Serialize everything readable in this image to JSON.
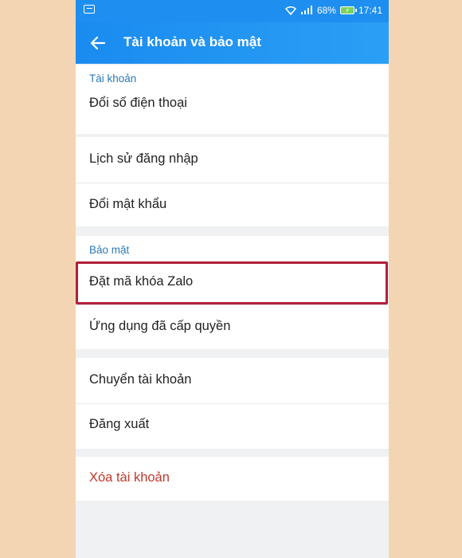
{
  "status": {
    "battery_percent": "68%",
    "time": "17:41"
  },
  "header": {
    "title": "Tài khoản và bảo mật"
  },
  "sections": {
    "account": {
      "label": "Tài khoản",
      "items": [
        "Đổi số điện thoại",
        "Lịch sử đăng nhập",
        "Đổi mật khẩu"
      ]
    },
    "security": {
      "label": "Bảo mật",
      "items": [
        "Đặt mã khóa Zalo",
        "Ứng dụng đã cấp quyền"
      ]
    },
    "other": {
      "items": [
        "Chuyển tài khoản",
        "Đăng xuất"
      ]
    },
    "danger": {
      "items": [
        "Xóa tài khoản"
      ]
    }
  },
  "colors": {
    "accent": "#1e8ff0",
    "section_label": "#2a7ab8",
    "danger": "#c0392b",
    "highlight": "#b0203a",
    "background": "#f4d5b3"
  }
}
